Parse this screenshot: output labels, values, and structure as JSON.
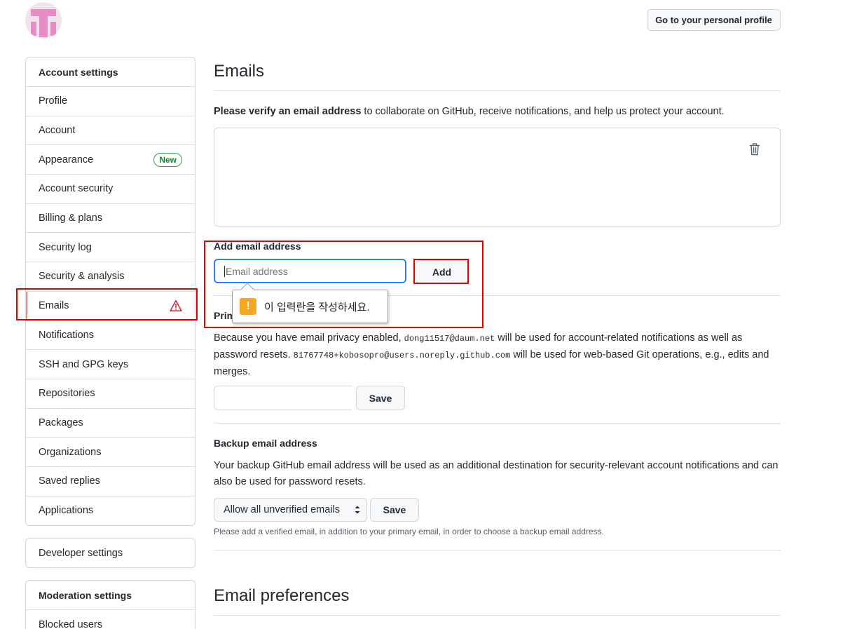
{
  "header": {
    "profile_button": "Go to your personal profile"
  },
  "sidebar": {
    "account_settings": {
      "heading": "Account settings",
      "items": [
        {
          "label": "Profile"
        },
        {
          "label": "Account"
        },
        {
          "label": "Appearance",
          "badge": "New"
        },
        {
          "label": "Account security"
        },
        {
          "label": "Billing & plans"
        },
        {
          "label": "Security log"
        },
        {
          "label": "Security & analysis"
        },
        {
          "label": "Emails",
          "icon": "alert-icon"
        },
        {
          "label": "Notifications"
        },
        {
          "label": "SSH and GPG keys"
        },
        {
          "label": "Repositories"
        },
        {
          "label": "Packages"
        },
        {
          "label": "Organizations"
        },
        {
          "label": "Saved replies"
        },
        {
          "label": "Applications"
        }
      ]
    },
    "developer_settings": "Developer settings",
    "moderation_settings": {
      "heading": "Moderation settings",
      "items": [
        {
          "label": "Blocked users"
        }
      ]
    }
  },
  "main": {
    "title": "Emails",
    "verify_bold": "Please verify an email address",
    "verify_rest": " to collaborate on GitHub, receive notifications, and help us protect your account.",
    "add_email": {
      "label": "Add email address",
      "placeholder": "Email address",
      "button": "Add"
    },
    "validation_tooltip": "이 입력란을 작성하세요.",
    "primary": {
      "label_visible": "Prim",
      "text_1": "Because you have email privacy enabled, ",
      "email_1": "dong11517@daum.net",
      "text_2": " will be used for account-related notifications as well as password resets. ",
      "email_2": "81767748+kobosopro@users.noreply.github.com",
      "text_3": " will be used for web-based Git operations, e.g., edits and merges.",
      "save": "Save"
    },
    "backup": {
      "label": "Backup email address",
      "text": "Your backup GitHub email address will be used as an additional destination for security-relevant account notifications and can also be used for password resets.",
      "select_value": "Allow all unverified emails",
      "save": "Save",
      "note": "Please add a verified email, in addition to your primary email, in order to choose a backup email address."
    },
    "preferences_title": "Email preferences"
  },
  "colors": {
    "highlight": "#e00000",
    "focus": "#2f81f7",
    "badge_green": "#1a7f37",
    "warning": "#f5a623"
  }
}
